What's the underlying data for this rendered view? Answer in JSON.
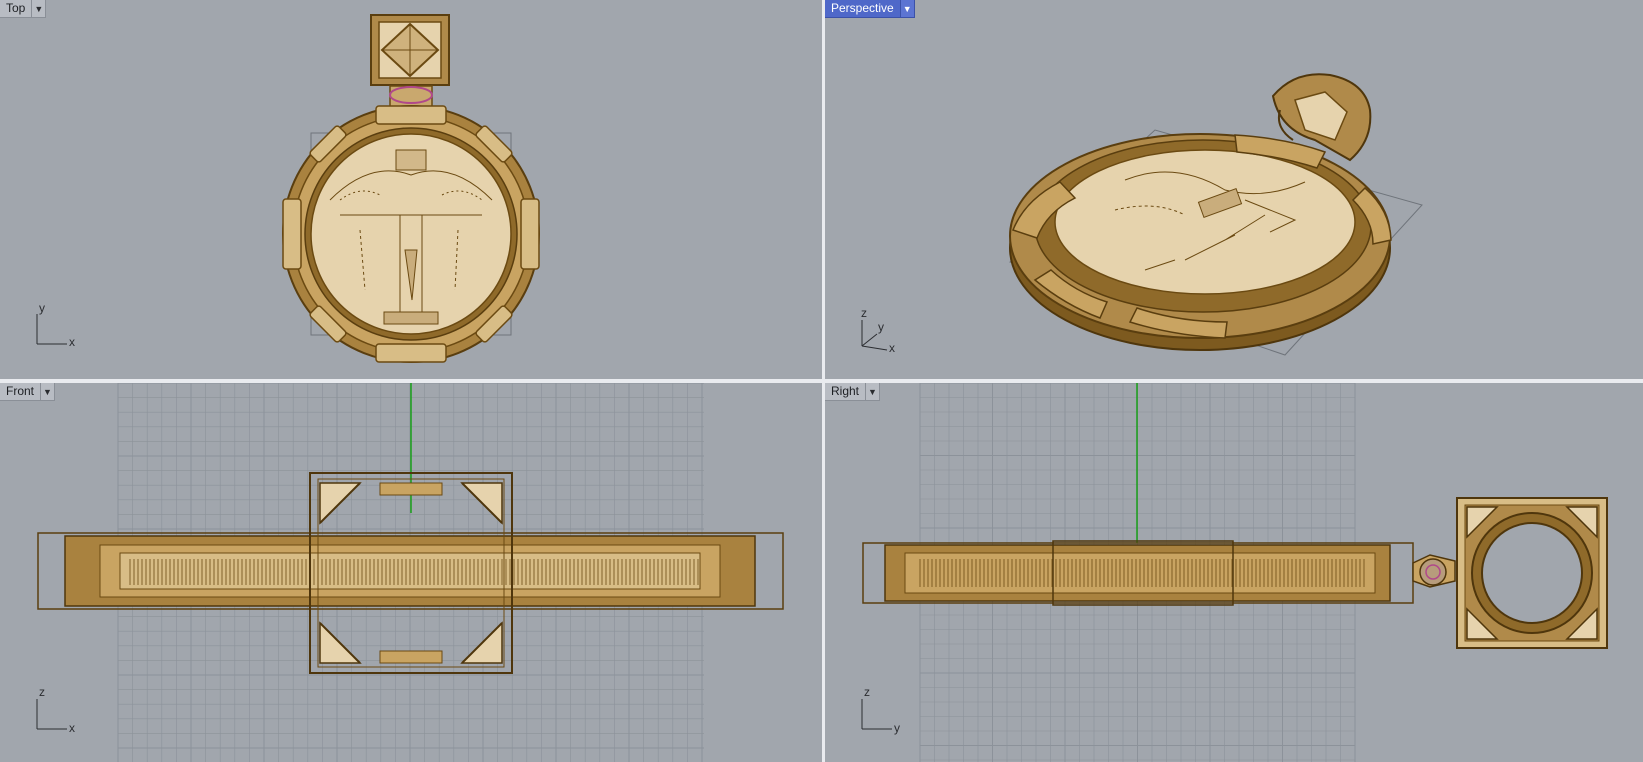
{
  "viewports": {
    "top": {
      "label": "Top",
      "axes": [
        "y",
        "x"
      ]
    },
    "perspective": {
      "label": "Perspective",
      "axes": [
        "z",
        "y",
        "x"
      ]
    },
    "front": {
      "label": "Front",
      "axes": [
        "z",
        "x"
      ]
    },
    "right": {
      "label": "Right",
      "axes": [
        "z",
        "y"
      ]
    }
  },
  "icons": {
    "dropdown": "chevron-down-icon",
    "axis": "axis-triad-icon"
  },
  "colors": {
    "viewport_bg": "#a1a6ad",
    "active_label_bg": "#4f68c9",
    "model_fill": "#e6d3ad",
    "model_wire": "#6b4a12",
    "model_gold": "#b08a4a",
    "z_axis_green": "#19a019",
    "grid": "#8c929a"
  }
}
